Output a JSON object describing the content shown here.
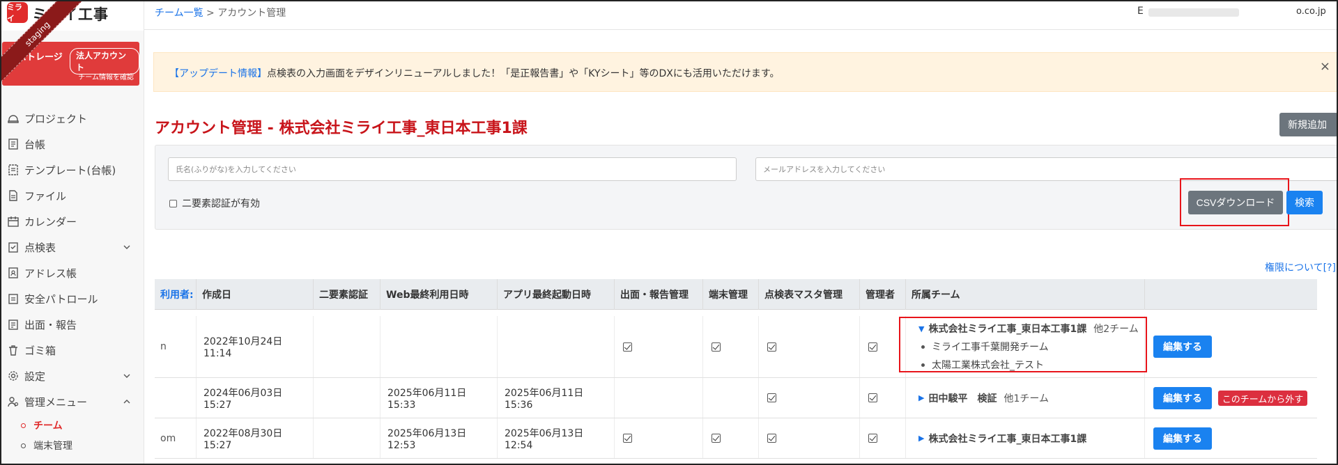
{
  "app": {
    "logo_mark": "ミライ",
    "logo_text": "ミライ工事",
    "staging_ribbon": "staging"
  },
  "plan": {
    "storage_label": "ストレージ",
    "badge": "法人アカウント",
    "team_info_link": "チーム情報を確認"
  },
  "sidebar": {
    "items": [
      {
        "label": "プロジェクト",
        "icon": "project-icon"
      },
      {
        "label": "台帳",
        "icon": "ledger-icon"
      },
      {
        "label": "テンプレート(台帳)",
        "icon": "template-icon"
      },
      {
        "label": "ファイル",
        "icon": "file-icon"
      },
      {
        "label": "カレンダー",
        "icon": "calendar-icon"
      },
      {
        "label": "点検表",
        "icon": "checklist-icon"
      },
      {
        "label": "アドレス帳",
        "icon": "address-book-icon"
      },
      {
        "label": "安全パトロール",
        "icon": "safety-patrol-icon"
      },
      {
        "label": "出面・報告",
        "icon": "report-icon"
      },
      {
        "label": "ゴミ箱",
        "icon": "trash-icon"
      },
      {
        "label": "設定",
        "icon": "gear-icon"
      },
      {
        "label": "管理メニュー",
        "icon": "admin-menu-icon"
      }
    ],
    "sub_items": [
      {
        "label": "チーム"
      },
      {
        "label": "端末管理"
      }
    ]
  },
  "breadcrumb": {
    "link": "チーム一覧",
    "separator": ">",
    "current": "アカウント管理"
  },
  "header": {
    "user_initial": "E",
    "email_suffix": "o.co.jp"
  },
  "alert": {
    "link": "【アップデート情報】",
    "text": "点検表の入力画面をデザインリニューアルしました！「是正報告書」や「KYシート」等のDXにも活用いただけます。",
    "close": "×"
  },
  "page": {
    "title": "アカウント管理 - 株式会社ミライ工事_東日本工事1課",
    "add_new": "新規追加"
  },
  "search": {
    "name_placeholder": "氏名(ふりがな)を入力してください",
    "email_placeholder": "メールアドレスを入力してください",
    "twofa_label": "二要素認証が有効",
    "csv_button": "CSVダウンロード",
    "search_button": "検索"
  },
  "permissions_link": "権限について[?]",
  "table": {
    "headers": [
      "利用者:",
      "作成日",
      "二要素認証",
      "Web最終利用日時",
      "アプリ最終起動日時",
      "出面・報告管理",
      "端末管理",
      "点検表マスタ管理",
      "管理者",
      "所属チーム"
    ],
    "edit_label": "編集する",
    "remove_label": "このチームから外す",
    "rows": [
      {
        "user": "n",
        "created": "2022年10月24日 11:14",
        "twofa": "",
        "web_last": "",
        "app_last": "",
        "team_main": "株式会社ミライ工事_東日本工事1課",
        "team_other": "他2チーム",
        "team_subs": [
          "ミライ工事千葉開発チーム",
          "太陽工業株式会社_テスト"
        ],
        "expanded": true
      },
      {
        "user": "",
        "created": "2024年06月03日 15:27",
        "twofa": "",
        "web_last": "2025年06月11日 15:33",
        "app_last": "2025年06月11日 15:36",
        "team_main": "田中駿平　検証",
        "team_other": "他1チーム",
        "team_subs": [],
        "expanded": false
      },
      {
        "user": "om",
        "created": "2022年08月30日 15:27",
        "twofa": "",
        "web_last": "2025年06月13日 12:53",
        "app_last": "2025年06月13日 12:54",
        "team_main": "株式会社ミライ工事_東日本工事1課",
        "team_other": "",
        "team_subs": [],
        "expanded": false
      }
    ]
  }
}
